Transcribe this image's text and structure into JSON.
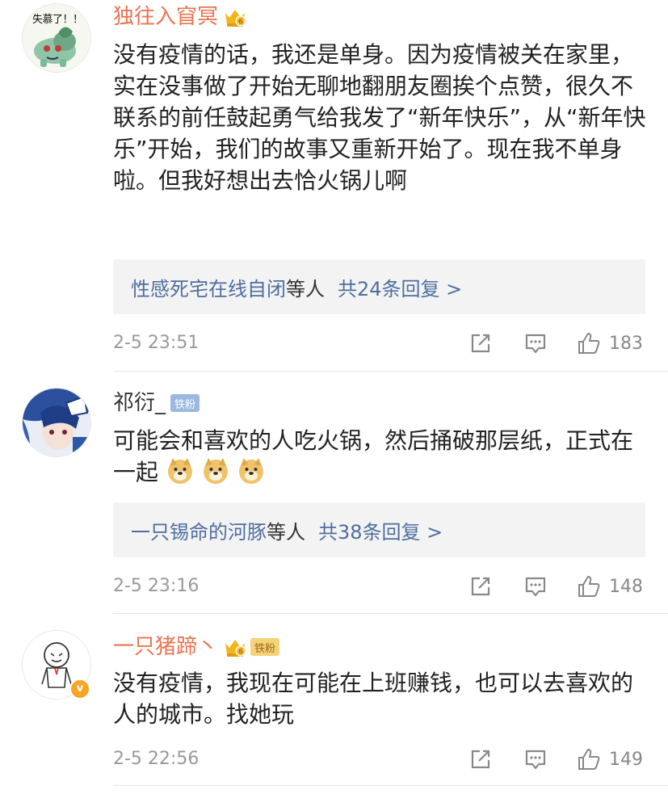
{
  "comments": [
    {
      "avatar_caption": "失慕了！！",
      "username": "独往入窅冥",
      "content": "没有疫情的话，我还是单身。因为疫情被关在家里，实在没事做了开始无聊地翻朋友圈挨个点赞，很久不联系的前任鼓起勇气给我发了“新年快乐”，从“新年快乐”开始，我们的故事又重新开始了。现在我不单身啦。但我好想出去恰火锅儿啊",
      "reply_names": "性感死宅在线自闭",
      "reply_suffix": "等人",
      "reply_count": "共24条回复 >",
      "timestamp": "2-5 23:51",
      "likes": "183"
    },
    {
      "username": "祁衍_",
      "fan_badge": "铁粉",
      "content": "可能会和喜欢的人吃火锅，然后捅破那层纸，正式在一起",
      "reply_names": "一只锡命的河豚",
      "reply_suffix": "等人",
      "reply_count": "共38条回复 >",
      "timestamp": "2-5 23:16",
      "likes": "148"
    },
    {
      "username": "一只猪蹄丶",
      "fan_badge": "铁粉",
      "verified_mark": "v",
      "content": "没有疫情，我现在可能在上班赚钱，也可以去喜欢的人的城市。找她玩",
      "timestamp": "2-5 22:56",
      "likes": "149"
    }
  ],
  "icons": {
    "share": "share-icon",
    "comment": "comment-icon",
    "like": "thumbs-up-icon",
    "crown": "vip-crown-icon",
    "emoji": "doge-emoji-icon"
  },
  "colors": {
    "vip_name": "#eb7350",
    "link_blue": "#4e6ea0",
    "reply_bg": "#f3f3f3",
    "meta_gray": "#999999"
  }
}
